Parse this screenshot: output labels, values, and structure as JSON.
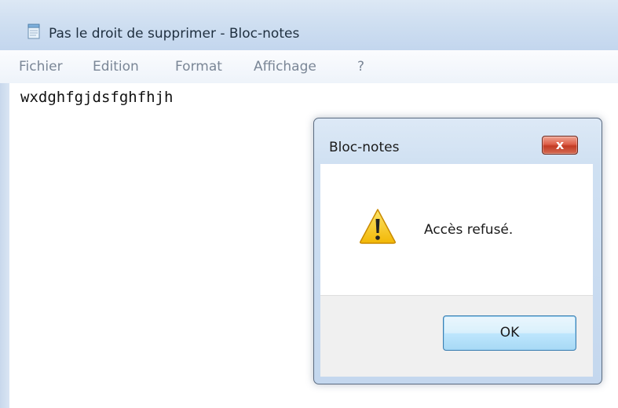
{
  "window": {
    "title": "Pas le droit de supprimer - Bloc-notes",
    "icon": "notepad-icon"
  },
  "menu": {
    "items": [
      "Fichier",
      "Edition",
      "Format",
      "Affichage",
      "?"
    ]
  },
  "editor": {
    "content": "wxdghfgjdsfghfhjh"
  },
  "dialog": {
    "title": "Bloc-notes",
    "close_symbol": "x",
    "icon": "warning-icon",
    "message": "Accès refusé.",
    "ok_label": "OK"
  },
  "colors": {
    "close_button": "#c33b24",
    "ok_button": "#bee6fd",
    "warning_fill": "#f6c90e"
  }
}
